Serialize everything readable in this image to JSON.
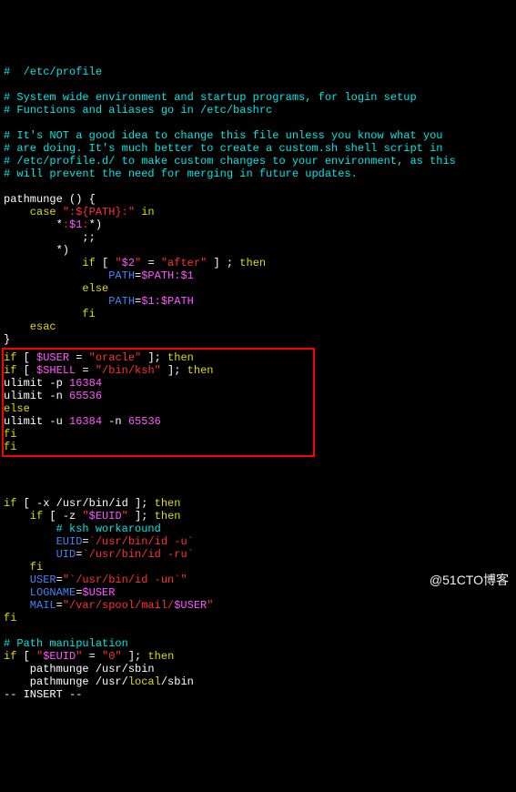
{
  "file_header": "#  /etc/profile",
  "comment_block1": [
    "# System wide environment and startup programs, for login setup",
    "# Functions and aliases go in /etc/bashrc"
  ],
  "comment_block2": [
    "# It's NOT a good idea to change this file unless you know what you",
    "# are doing. It's much better to create a custom.sh shell script in",
    "# /etc/profile.d/ to make custom changes to your environment, as this",
    "# will prevent the need for merging in future updates."
  ],
  "fn": {
    "line1a": "pathmunge ",
    "line1b": "()",
    "line1c": " {",
    "case_kw": "    case ",
    "case_q1": "\"",
    "case_path": ":${PATH}:",
    "case_q2": "\"",
    "case_in": " in",
    "pat1a": "        *",
    "pat1_q1": ":",
    "pat1_v": "$1",
    "pat1_q2": ":",
    "pat1b": "*)",
    "dsemi": "            ;;",
    "pat2": "        *)",
    "if_kw": "            if ",
    "if_br1": "[ ",
    "if_q1": "\"",
    "if_v2": "$2",
    "if_q2": "\"",
    "if_eq": " = ",
    "if_q3": "\"after\"",
    "if_br2": " ]",
    "if_semi": " ; ",
    "then_kw1": "then",
    "assign1_name": "                PATH",
    "assign1_eq": "=",
    "assign1_val": "$PATH:$1",
    "else_kw": "            else",
    "assign2_name": "                PATH",
    "assign2_eq": "=",
    "assign2_val": "$1:$PATH",
    "fi_kw1": "            fi",
    "esac_kw": "    esac",
    "brace_close": "}"
  },
  "boxed": {
    "l1_if": "if ",
    "l1_br1": "[ ",
    "l1_var": "$USER",
    "l1_eq": " = ",
    "l1_str": "\"oracle\"",
    "l1_br2": " ];",
    "l1_then": " then",
    "l2_if": "if ",
    "l2_br1": "[ ",
    "l2_var": "$SHELL",
    "l2_eq": " = ",
    "l2_str": "\"/bin/ksh\"",
    "l2_br2": " ];",
    "l2_then": " then",
    "l3a": "ulimit -p ",
    "l3b": "16384",
    "l4a": "ulimit -n ",
    "l4b": "65536",
    "l5": "else",
    "l6a": "ulimit -u ",
    "l6b": "16384",
    "l6c": " -n ",
    "l6d": "65536",
    "l7": "fi",
    "l8": "fi"
  },
  "body2": {
    "if1a": "if ",
    "if1b": "[",
    "if1c": " -x /usr/bin/id ",
    "if1d": "];",
    "if1_then": " then",
    "if2a": "    if ",
    "if2b": "[",
    "if2c": " -z ",
    "if2_q1": "\"",
    "if2_var": "$EUID",
    "if2_q2": "\"",
    "if2d": " ];",
    "if2_then": " then",
    "cmt": "        # ksh workaround",
    "euid_name": "        EUID",
    "euid_eq": "=",
    "euid_val": "`/usr/bin/id -u`",
    "uid_name": "        UID",
    "uid_eq": "=",
    "uid_val": "`/usr/bin/id -ru`",
    "fi_inner": "    fi",
    "user_name": "    USER",
    "user_eq": "=",
    "user_q1": "\"",
    "user_val": "`/usr/bin/id -un`",
    "user_q2": "\"",
    "log_name": "    LOGNAME",
    "log_eq": "=",
    "log_val": "$USER",
    "mail_name": "    MAIL",
    "mail_eq": "=",
    "mail_q1": "\"",
    "mail_p1": "/var/spool/mail/",
    "mail_var": "$USER",
    "mail_q2": "\"",
    "fi_outer": "fi"
  },
  "path_manip": {
    "cmt": "# Path manipulation",
    "if_a": "if ",
    "if_b": "[ ",
    "if_q1": "\"",
    "if_var": "$EUID",
    "if_q2": "\"",
    "if_eq": " = ",
    "if_str": "\"0\"",
    "if_c": " ];",
    "if_then": " then",
    "pm1": "    pathmunge /usr/sbin",
    "pm2_a": "    pathmunge /usr/",
    "pm2_b": "local",
    "pm2_c": "/sbin"
  },
  "status_line": "-- INSERT --",
  "watermark_text": "@51CTO博客"
}
